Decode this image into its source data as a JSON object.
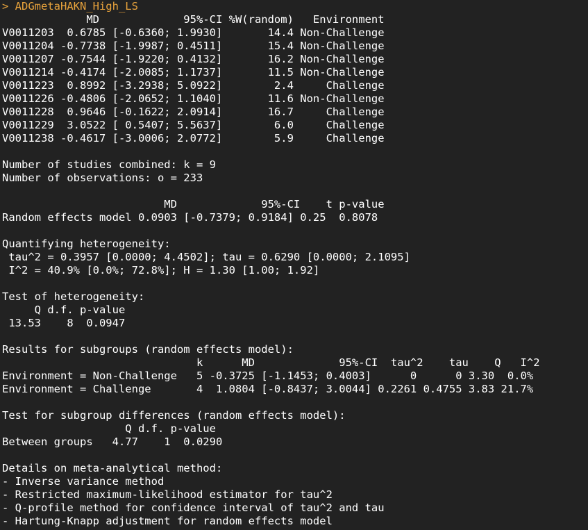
{
  "console": {
    "command_line": "> ADGmetaHAKN_High_LS",
    "lines": [
      "             MD             95%-CI %W(random)   Environment",
      "V0011203  0.6785 [-0.6360; 1.9930]       14.4 Non-Challenge",
      "V0011204 -0.7738 [-1.9987; 0.4511]       15.4 Non-Challenge",
      "V0011207 -0.7544 [-1.9220; 0.4132]       16.2 Non-Challenge",
      "V0011214 -0.4174 [-2.0085; 1.1737]       11.5 Non-Challenge",
      "V0011223  0.8992 [-3.2938; 5.0922]        2.4     Challenge",
      "V0011226 -0.4806 [-2.0652; 1.1040]       11.6 Non-Challenge",
      "V0011228  0.9646 [-0.1622; 2.0914]       16.7     Challenge",
      "V0011229  3.0522 [ 0.5407; 5.5637]        6.0     Challenge",
      "V0011238 -0.4617 [-3.0006; 2.0772]        5.9     Challenge",
      "",
      "Number of studies combined: k = 9",
      "Number of observations: o = 233",
      "",
      "                         MD             95%-CI    t p-value",
      "Random effects model 0.0903 [-0.7379; 0.9184] 0.25  0.8078",
      "",
      "Quantifying heterogeneity:",
      " tau^2 = 0.3957 [0.0000; 4.4502]; tau = 0.6290 [0.0000; 2.1095]",
      " I^2 = 40.9% [0.0%; 72.8%]; H = 1.30 [1.00; 1.92]",
      "",
      "Test of heterogeneity:",
      "     Q d.f. p-value",
      " 13.53    8  0.0947",
      "",
      "Results for subgroups (random effects model):",
      "                              k      MD             95%-CI  tau^2    tau    Q   I^2",
      "Environment = Non-Challenge   5 -0.3725 [-1.1453; 0.4003]      0      0 3.30  0.0%",
      "Environment = Challenge       4  1.0804 [-0.8437; 3.0044] 0.2261 0.4755 3.83 21.7%",
      "",
      "Test for subgroup differences (random effects model):",
      "                   Q d.f. p-value",
      "Between groups   4.77    1  0.0290",
      "",
      "Details on meta-analytical method:",
      "- Inverse variance method",
      "- Restricted maximum-likelihood estimator for tau^2",
      "- Q-profile method for confidence interval of tau^2 and tau",
      "- Hartung-Knapp adjustment for random effects model"
    ]
  }
}
